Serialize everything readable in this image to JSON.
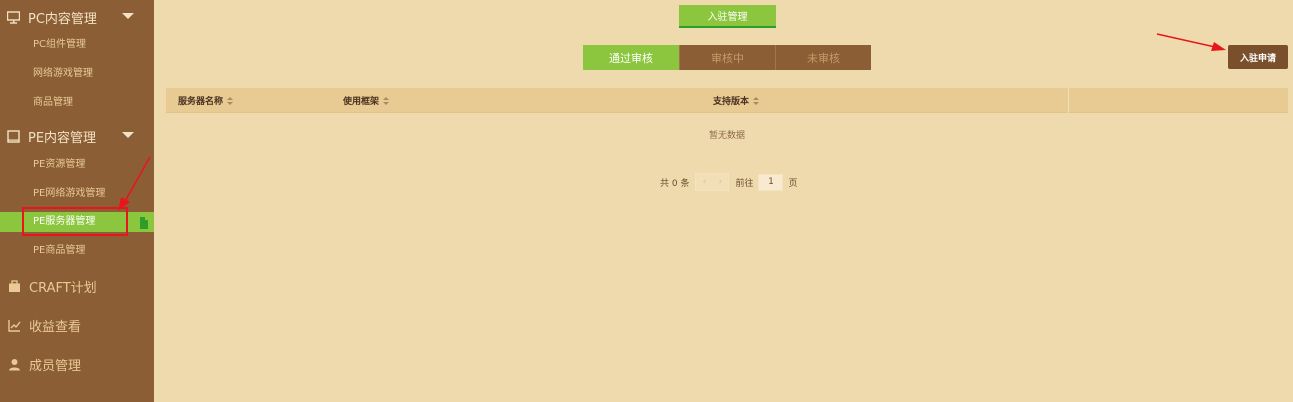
{
  "sidebar": {
    "groups": [
      {
        "label": "PC内容管理",
        "items": [
          "PC组件管理",
          "网络游戏管理",
          "商品管理"
        ]
      },
      {
        "label": "PE内容管理",
        "items": [
          "PE资源管理",
          "PE网络游戏管理",
          "PE服务器管理",
          "PE商品管理"
        ]
      }
    ],
    "active_item": "PE服务器管理",
    "links": [
      "CRAFT计划",
      "收益查看",
      "成员管理"
    ]
  },
  "main": {
    "top_button": "入驻管理",
    "segments": [
      "通过审核",
      "审核中",
      "未审核"
    ],
    "active_segment": "通过审核",
    "apply_button": "入驻申请",
    "table": {
      "headers": [
        "服务器名称",
        "使用框架",
        "支持版本"
      ],
      "empty_text": "暂无数据"
    },
    "pagination": {
      "total_text": "共 0 条",
      "goto_label": "前往",
      "page_value": "1",
      "page_suffix": "页"
    }
  },
  "colors": {
    "sidebar_bg": "#8b5e36",
    "page_bg": "#efdaae",
    "accent_green": "#8cc63f",
    "annotation_red": "#e8161b"
  }
}
